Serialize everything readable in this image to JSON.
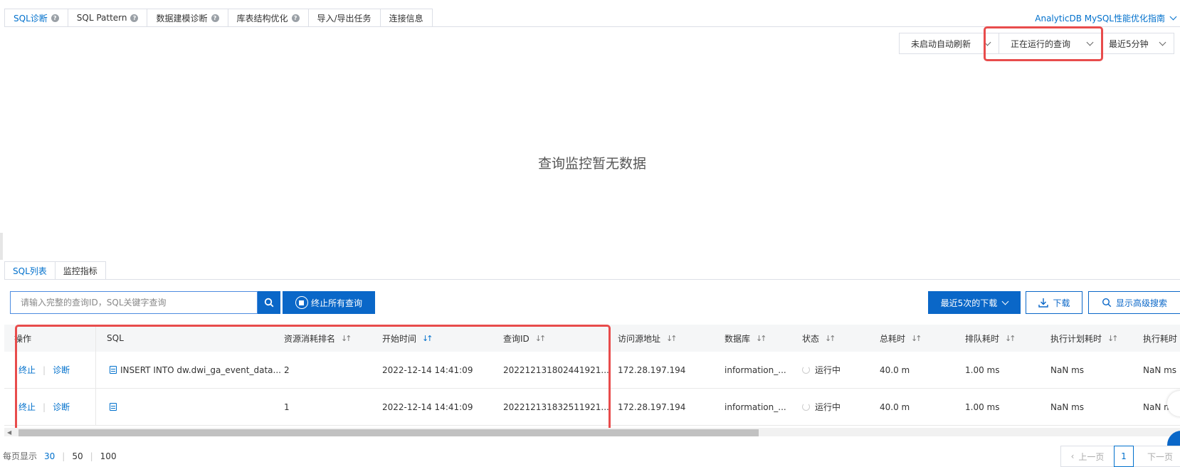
{
  "top_tabs": [
    {
      "label": "SQL诊断",
      "help": true
    },
    {
      "label": "SQL Pattern",
      "help": true
    },
    {
      "label": "数据建模诊断",
      "help": true
    },
    {
      "label": "库表结构优化",
      "help": true
    },
    {
      "label": "导入/导出任务",
      "help": false
    },
    {
      "label": "连接信息",
      "help": false
    }
  ],
  "guide_link": "AnalyticDB MySQL性能优化指南",
  "filters": {
    "auto_refresh": "未启动自动刷新",
    "query_type": "正在运行的查询",
    "time_range": "最近5分钟"
  },
  "empty_message": "查询监控暂无数据",
  "sub_tabs": [
    "SQL列表",
    "监控指标"
  ],
  "search": {
    "placeholder": "请输入完整的查询ID，SQL关键字查询"
  },
  "buttons": {
    "stop_all": "终止所有查询",
    "recent_downloads": "最近5次的下载",
    "download": "下载",
    "advanced_search": "显示高级搜索"
  },
  "table": {
    "headers": [
      "操作",
      "SQL",
      "资源消耗排名",
      "开始时间",
      "查询ID",
      "访问源地址",
      "数据库",
      "状态",
      "总耗时",
      "排队耗时",
      "执行计划耗时",
      "执行耗时"
    ],
    "action_stop": "终止",
    "action_diagnose": "诊断",
    "rows": [
      {
        "sql": "INSERT INTO dw.dwi_ga_event_data...",
        "rank": "2",
        "start_time": "2022-12-14 14:41:09",
        "query_id": "202212131802441921...",
        "source": "172.28.197.194",
        "database": "information_...",
        "status": "运行中",
        "total": "40.0 m",
        "queue": "1.00 ms",
        "plan": "NaN ms",
        "exec": "NaN ms"
      },
      {
        "sql": "",
        "rank": "1",
        "start_time": "2022-12-14 14:41:09",
        "query_id": "202212131832511921...",
        "source": "172.28.197.194",
        "database": "information_...",
        "status": "运行中",
        "total": "40.0 m",
        "queue": "1.00 ms",
        "plan": "NaN ms",
        "exec": "NaN ms"
      }
    ]
  },
  "pagination": {
    "label": "每页显示",
    "sizes": [
      "30",
      "50",
      "100"
    ],
    "current_size": "30",
    "prev": "上一页",
    "next": "下一页",
    "current_page": "1"
  },
  "colors": {
    "accent": "#0a67c8",
    "highlight_box": "#e84c4c"
  }
}
